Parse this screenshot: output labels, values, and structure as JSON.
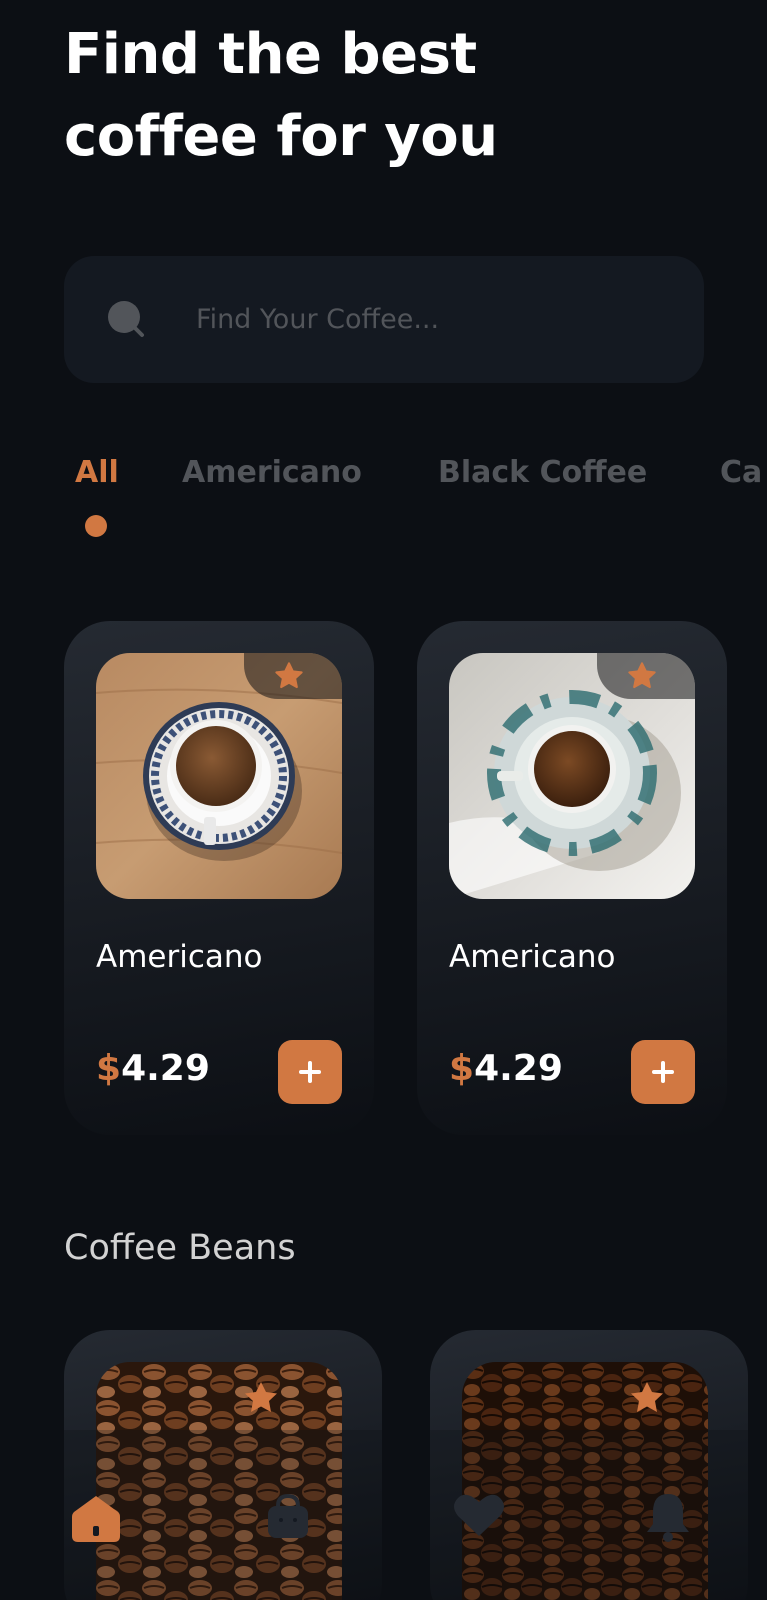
{
  "header": {
    "title_line1": "Find the best",
    "title_line2": "coffee for you"
  },
  "search": {
    "placeholder": "Find Your Coffee...",
    "value": "",
    "icon": "search-icon"
  },
  "tabs": [
    {
      "label": "All",
      "active": true
    },
    {
      "label": "Americano",
      "active": false
    },
    {
      "label": "Black Coffee",
      "active": false
    },
    {
      "label": "Ca",
      "active": false
    }
  ],
  "coffee_cards": [
    {
      "name": "Americano",
      "currency": "$",
      "price": "4.29",
      "rating_icon": "star-icon",
      "add_icon": "plus-icon"
    },
    {
      "name": "Americano",
      "currency": "$",
      "price": "4.29",
      "rating_icon": "star-icon",
      "add_icon": "plus-icon"
    }
  ],
  "beans_section": {
    "title": "Coffee Beans"
  },
  "bottom_nav": {
    "items": [
      "home-icon",
      "bag-icon",
      "heart-icon",
      "bell-icon"
    ],
    "active": "home-icon"
  },
  "colors": {
    "background": "#0c0f14",
    "accent": "#d17842",
    "card": "#252a32",
    "search_bg": "#141921",
    "muted_text": "#52555a"
  }
}
